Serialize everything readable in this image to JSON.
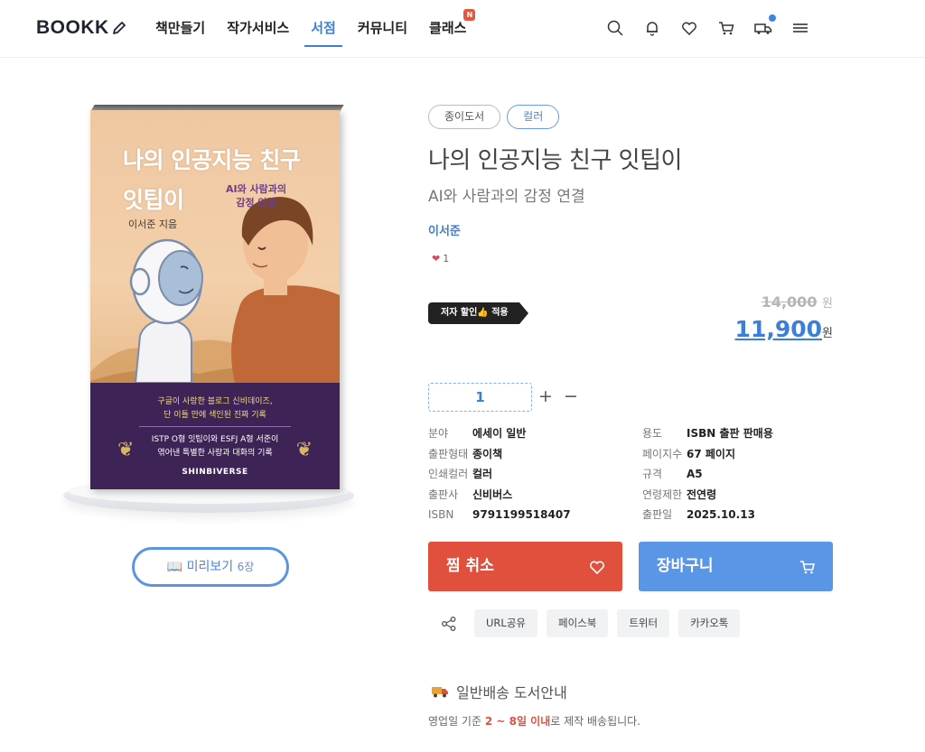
{
  "header": {
    "logo": "BOOKK",
    "nav": [
      {
        "label": "책만들기",
        "active": false
      },
      {
        "label": "작가서비스",
        "active": false
      },
      {
        "label": "서점",
        "active": true
      },
      {
        "label": "커뮤니티",
        "active": false
      },
      {
        "label": "클래스",
        "active": false,
        "badge": "N"
      }
    ],
    "icons": [
      "search-icon",
      "bell-icon",
      "heart-icon",
      "cart-icon",
      "delivery-truck-icon",
      "menu-icon"
    ]
  },
  "cover": {
    "title_line1": "나의 인공지능 친구",
    "title_line2": "잇팁이",
    "subtitle_line1": "AI와 사람과의",
    "subtitle_line2": "감정 연결",
    "author": "이서준 지음",
    "band_line1": "구글이 사랑한 블로그 신비데이즈,",
    "band_line2": "단 이틀 만에 색인된 진짜 기록",
    "band_line3": "ISTP O형 잇팁이와 ESFJ A형 서준이",
    "band_line4": "엮어낸 특별한 사랑과 대화의 기록",
    "brand": "SHINBIVERSE"
  },
  "preview": {
    "label": "미리보기",
    "count": "6장"
  },
  "product": {
    "tags": [
      "종이도서",
      "컬러"
    ],
    "title": "나의 인공지능 친구 잇팁이",
    "subtitle": "AI와 사람과의 감정 연결",
    "author": "이서준",
    "likes": "1",
    "discount_badge": "저자 할인👍 적용",
    "original_price": "14,000",
    "sale_price": "11,900",
    "currency": "원",
    "quantity": "1",
    "plus": "+",
    "minus": "−"
  },
  "specs_left": [
    {
      "key": "분야",
      "value": "에세이 일반"
    },
    {
      "key": "출판형태",
      "value": "종이책"
    },
    {
      "key": "인쇄컬러",
      "value": "컬러"
    },
    {
      "key": "출판사",
      "value": "신비버스"
    },
    {
      "key": "ISBN",
      "value": "9791199518407"
    }
  ],
  "specs_right": [
    {
      "key": "용도",
      "value": "ISBN 출판 판매용"
    },
    {
      "key": "페이지수",
      "value": "67 페이지"
    },
    {
      "key": "규격",
      "value": "A5"
    },
    {
      "key": "연령제한",
      "value": "전연령"
    },
    {
      "key": "출판일",
      "value": "2025.10.13"
    }
  ],
  "actions": {
    "wish": "찜 취소",
    "cart": "장바구니"
  },
  "share": [
    "URL공유",
    "페이스북",
    "트위터",
    "카카오톡"
  ],
  "shipping": {
    "title": "일반배송 도서안내",
    "desc_prefix": "영업일 기준 ",
    "desc_highlight": "2 ~ 8일 이내",
    "desc_suffix": "로 제작 배송됩니다."
  },
  "colors": {
    "accent": "#3d7fd8",
    "wish": "#e1503d",
    "cart": "#5b95e6",
    "band": "#3e2456"
  }
}
